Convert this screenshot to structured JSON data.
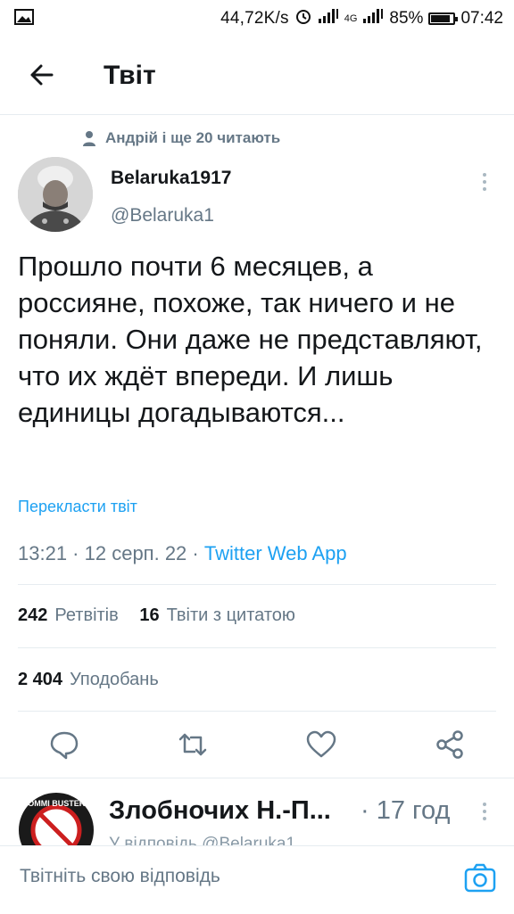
{
  "status_bar": {
    "network_speed": "44,72K/s",
    "network_type": "4G",
    "battery": "85%",
    "battery_level": 0.85,
    "time": "07:42",
    "icons": [
      "image-icon",
      "alarm-icon",
      "signal-icon",
      "signal-icon",
      "battery-icon"
    ]
  },
  "header": {
    "title": "Твіт"
  },
  "social_context": "Андрій і ще 20 читають",
  "tweet": {
    "author_name": "Belaruka1917",
    "author_handle": "@Belaruka1",
    "text": "Прошло почти 6 месяцев, а россияне, похоже, так ничего и не поняли. Они даже не представляют, что их ждёт впереди. И лишь единицы догадываются...",
    "translate_label": "Перекласти твіт",
    "time": "13:21",
    "date": "12 серп. 22",
    "source": "Twitter Web App",
    "retweets_count": "242",
    "retweets_label": "Ретвітів",
    "quotes_count": "16",
    "quotes_label": "Твіти з цитатою",
    "likes_count": "2 404",
    "likes_label": "Уподобань"
  },
  "reply": {
    "author_name": "Злобночих Н.-П...",
    "time": "· 17 год",
    "reply_to": "У відповідь @Belaruka1",
    "avatar_text": "COMMI BUSTERS"
  },
  "composer": {
    "placeholder": "Твітніть свою відповідь"
  },
  "colors": {
    "accent": "#1da1f2",
    "secondary_text": "#657786",
    "divider": "#e6ecf0"
  }
}
